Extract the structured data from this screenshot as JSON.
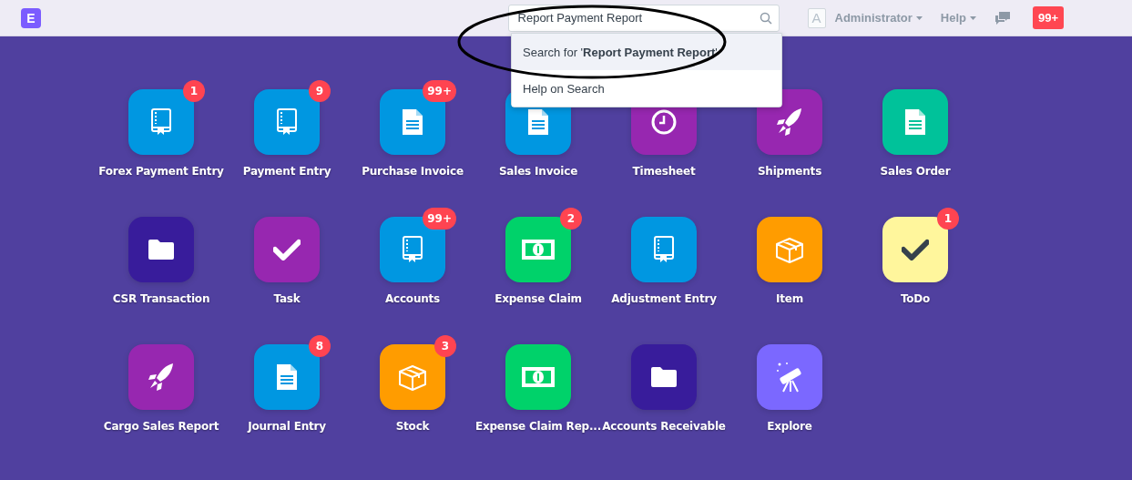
{
  "navbar": {
    "logo": "E",
    "search": {
      "value": "Report Payment Report"
    },
    "avatar": "A",
    "user_menu": "Administrator",
    "help_menu": "Help",
    "notifications": "99+"
  },
  "search_dropdown": [
    {
      "text": "Search for '**Report Payment Report**'",
      "selected": true
    },
    {
      "text": "Help on Search",
      "selected": false
    }
  ],
  "modules": [
    {
      "label": "Forex Payment Entry",
      "kind": "book",
      "color": "#0097e1",
      "badge": "1"
    },
    {
      "label": "Payment Entry",
      "kind": "book",
      "color": "#0097e1",
      "badge": "9"
    },
    {
      "label": "Purchase Invoice",
      "kind": "doc",
      "color": "#0097e1",
      "badge": "99+"
    },
    {
      "label": "Sales Invoice",
      "kind": "doc",
      "color": "#0097e1"
    },
    {
      "label": "Timesheet",
      "kind": "clock",
      "color": "#9727b0"
    },
    {
      "label": "Shipments",
      "kind": "rocket",
      "color": "#9727b0"
    },
    {
      "label": "Sales Order",
      "kind": "doc",
      "color": "#00c29a"
    },
    {
      "label": "CSR Transaction",
      "kind": "folder",
      "color": "#381c9b"
    },
    {
      "label": "Task",
      "kind": "check",
      "color": "#9727b0"
    },
    {
      "label": "Accounts",
      "kind": "book",
      "color": "#0097e1",
      "badge": "99+"
    },
    {
      "label": "Expense Claim",
      "kind": "money",
      "color": "#00d26a",
      "badge": "2"
    },
    {
      "label": "Adjustment Entry",
      "kind": "book",
      "color": "#0097e1"
    },
    {
      "label": "Item",
      "kind": "box",
      "color": "#ff9c00"
    },
    {
      "label": "ToDo",
      "kind": "check",
      "color": "#fff69c",
      "badge": "1"
    },
    {
      "label": "Cargo Sales Report",
      "kind": "rocket",
      "color": "#9727b0"
    },
    {
      "label": "Journal Entry",
      "kind": "doc",
      "color": "#0097e1",
      "badge": "8"
    },
    {
      "label": "Stock",
      "kind": "box",
      "color": "#ff9c00",
      "badge": "3"
    },
    {
      "label": "Expense Claim Rep...",
      "kind": "money",
      "color": "#00d26a"
    },
    {
      "label": "Accounts Receivable",
      "kind": "folder",
      "color": "#381c9b"
    },
    {
      "label": "Explore",
      "kind": "telescope",
      "color": "#7b68ff"
    }
  ]
}
